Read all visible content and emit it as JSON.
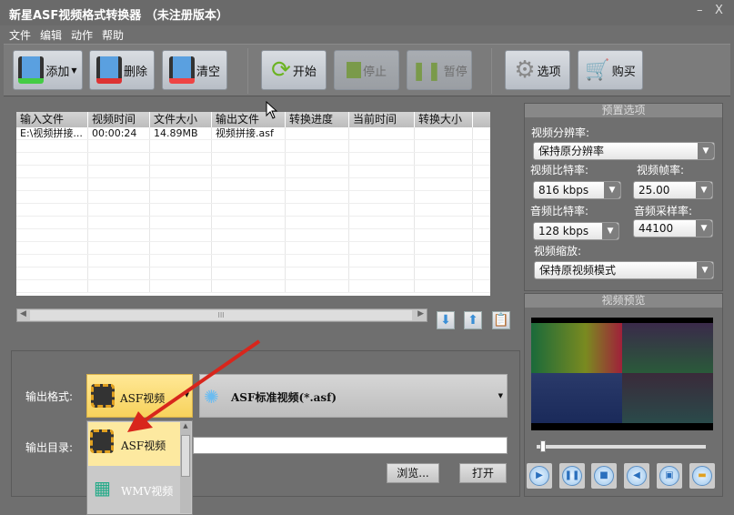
{
  "window": {
    "title": "新星ASF视频格式转换器 （未注册版本）",
    "minimize": "–",
    "close": "X"
  },
  "menu": [
    "文件",
    "编辑",
    "动作",
    "帮助"
  ],
  "toolbar": {
    "add": "添加",
    "delete": "删除",
    "clear": "清空",
    "start": "开始",
    "stop": "停止",
    "pause": "暂停",
    "options": "选项",
    "buy": "购买"
  },
  "table": {
    "columns": [
      "输入文件",
      "视频时间",
      "文件大小",
      "输出文件",
      "转换进度",
      "当前时间",
      "转换大小"
    ],
    "rows": [
      [
        "E:\\视频拼接...",
        "00:00:24",
        "14.89MB",
        "视频拼接.asf",
        "",
        "",
        ""
      ]
    ]
  },
  "scrollbar": {
    "grip": "III"
  },
  "output": {
    "format_label": "输出格式:",
    "format_value": "ASF视频",
    "profile_value": "ASF标准视频(*.asf)",
    "dir_label": "输出目录:",
    "dir_value": "",
    "browse": "浏览...",
    "open": "打开",
    "dropdown_items": [
      "ASF视频",
      "WMV视频"
    ]
  },
  "presets": {
    "title": "预置选项",
    "resolution_label": "视频分辨率:",
    "resolution": "保持原分辨率",
    "vbitrate_label": "视频比特率:",
    "vbitrate": "816 kbps",
    "fps_label": "视频帧率:",
    "fps": "25.00",
    "abitrate_label": "音频比特率:",
    "abitrate": "128 kbps",
    "samplerate_label": "音频采样率:",
    "samplerate": "44100",
    "scale_label": "视频缩放:",
    "scale": "保持原视频模式"
  },
  "preview": {
    "title": "视频预览",
    "slider_position": 0.02
  }
}
